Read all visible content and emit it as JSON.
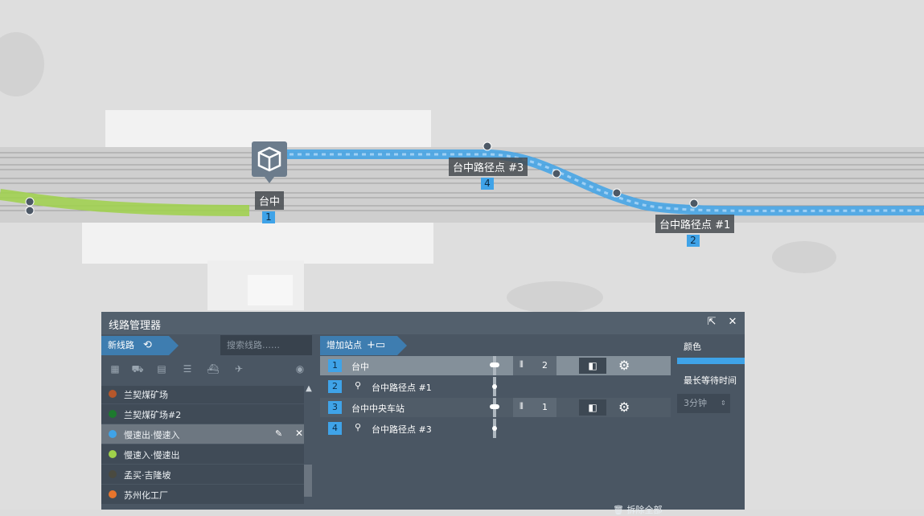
{
  "map": {
    "stations": [
      {
        "name": "台中",
        "num": "1"
      },
      {
        "name": "台中路径点 #3",
        "num": "4"
      },
      {
        "name": "台中路径点 #1",
        "num": "2"
      }
    ],
    "route_color": "#3fa3e8",
    "other_route_color": "#9fd14a"
  },
  "panel": {
    "title": "线路管理器",
    "new_line": "新线路",
    "search_placeholder": "搜索线路……",
    "add_stop": "增加站点",
    "lines": [
      {
        "label": "兰契煤矿场",
        "color": "#b5572b"
      },
      {
        "label": "兰契煤矿场#2",
        "color": "#1d7a2e"
      },
      {
        "label": "慢速出·慢速入",
        "color": "#3fa3e8",
        "selected": true
      },
      {
        "label": "慢速入·慢速出",
        "color": "#9fd14a"
      },
      {
        "label": "孟买·吉隆坡",
        "color": "#4a4a40"
      },
      {
        "label": "苏州化工厂",
        "color": "#e8752c"
      }
    ],
    "stops": [
      {
        "num": "1",
        "name": "台中",
        "type": "station",
        "cars": "2"
      },
      {
        "num": "2",
        "name": "台中路径点 #1",
        "type": "waypoint"
      },
      {
        "num": "3",
        "name": "台中中央车站",
        "type": "station",
        "cars": "1"
      },
      {
        "num": "4",
        "name": "台中路径点 #3",
        "type": "waypoint"
      }
    ],
    "color_label": "颜色",
    "color_value": "#3fa3e8",
    "max_wait_label": "最长等待时间",
    "max_wait_value": "3分钟",
    "remove_all": "拆除全部"
  }
}
